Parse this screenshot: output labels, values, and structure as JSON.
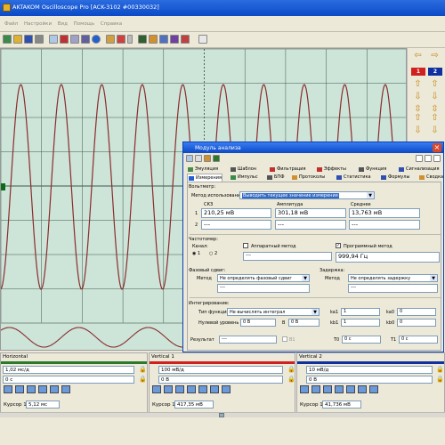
{
  "window": {
    "title": "AKTAKOM Oscilloscope Pro [ACK-3102 #00330032]"
  },
  "menu": [
    "Файл",
    "Настройки",
    "Вид",
    "Помощь",
    "Справка"
  ],
  "scope": {
    "background": "#cde4d8",
    "trace_color": "#8b2d2d",
    "grid_color": "#3b5a4a"
  },
  "right_panel": {
    "channel1_label": "1",
    "channel2_label": "2",
    "channel1_color": "#d02020",
    "channel2_color": "#1030a0"
  },
  "dialog": {
    "title": "Модуль анализа",
    "tabs_row1": [
      "Эмуляция",
      "Шаблон",
      "Фильтрация",
      "Эффекты",
      "Функция",
      "Сигнализация"
    ],
    "tabs_row2": [
      "Измерения",
      "Импульс",
      "БПФ",
      "Протоколы",
      "Статистика",
      "Формулы",
      "Сводка"
    ],
    "voltmeter": {
      "group_label": "Вольтметр:",
      "method_label": "Метод использования",
      "method_value": "Выводить текущее значение измерения",
      "col_rms": "СКЗ",
      "col_amp": "Амплитуда",
      "col_avg": "Среднее",
      "row1_num": "1",
      "row2_num": "2",
      "row1_rms": "210,25 мВ",
      "row1_amp": "301,18 мВ",
      "row1_avg": "13,763 мВ",
      "row2_rms": "---",
      "row2_amp": "---",
      "row2_avg": "---"
    },
    "freq": {
      "group_label": "Частотомер:",
      "channel_label": "Канал:",
      "ch1": "1",
      "ch2": "2",
      "hw_method": "Аппаратный метод",
      "sw_method": "Программный метод",
      "hw_value": "---",
      "sw_value": "999,94 Гц"
    },
    "phase": {
      "group_label": "Фазовый сдвиг:",
      "method_label": "Метод",
      "method_value": "Не определять фазовый сдвиг",
      "value": "---"
    },
    "delay": {
      "group_label": "Задержка:",
      "method_label": "Метод",
      "method_value": "Не определять задержку",
      "value": "---"
    },
    "integ": {
      "group_label": "Интегрирование:",
      "func_label": "Тип функции:",
      "func_value": "Не вычислять интеграл",
      "zero_label": "Нулевой уровень А",
      "zero_a": "0 В",
      "b_label": "В",
      "zero_b": "0 В",
      "ka1_label": "ka1",
      "ka1": "1",
      "ka0_label": "ka0",
      "ka0": "0",
      "kb1_label": "kb1",
      "kb1": "1",
      "kb0_label": "kb0",
      "kb0": "0",
      "result_label": "Результат",
      "result_value": "---",
      "b1_label": "В1",
      "t0_label": "T0",
      "t0": "0 с",
      "t1_label": "T1",
      "t1": "0 с"
    }
  },
  "bottom": {
    "horizontal": {
      "title": "Horizontal",
      "scale": "1,02 мс/д",
      "offset": "0 с",
      "cursor_label": "Курсор 1",
      "cursor_value": "5,12 мс"
    },
    "vertical1": {
      "title": "Vertical 1",
      "scale": "100 мВ/д",
      "offset": "0 В",
      "cursor_label": "Курсор 1",
      "cursor_value": "417,35 мВ",
      "color": "#d02020"
    },
    "vertical2": {
      "title": "Vertical 2",
      "scale": "10 мВ/д",
      "offset": "0 В",
      "cursor_label": "Курсор 1",
      "cursor_value": "41,736 мВ",
      "color": "#1030a0"
    }
  }
}
